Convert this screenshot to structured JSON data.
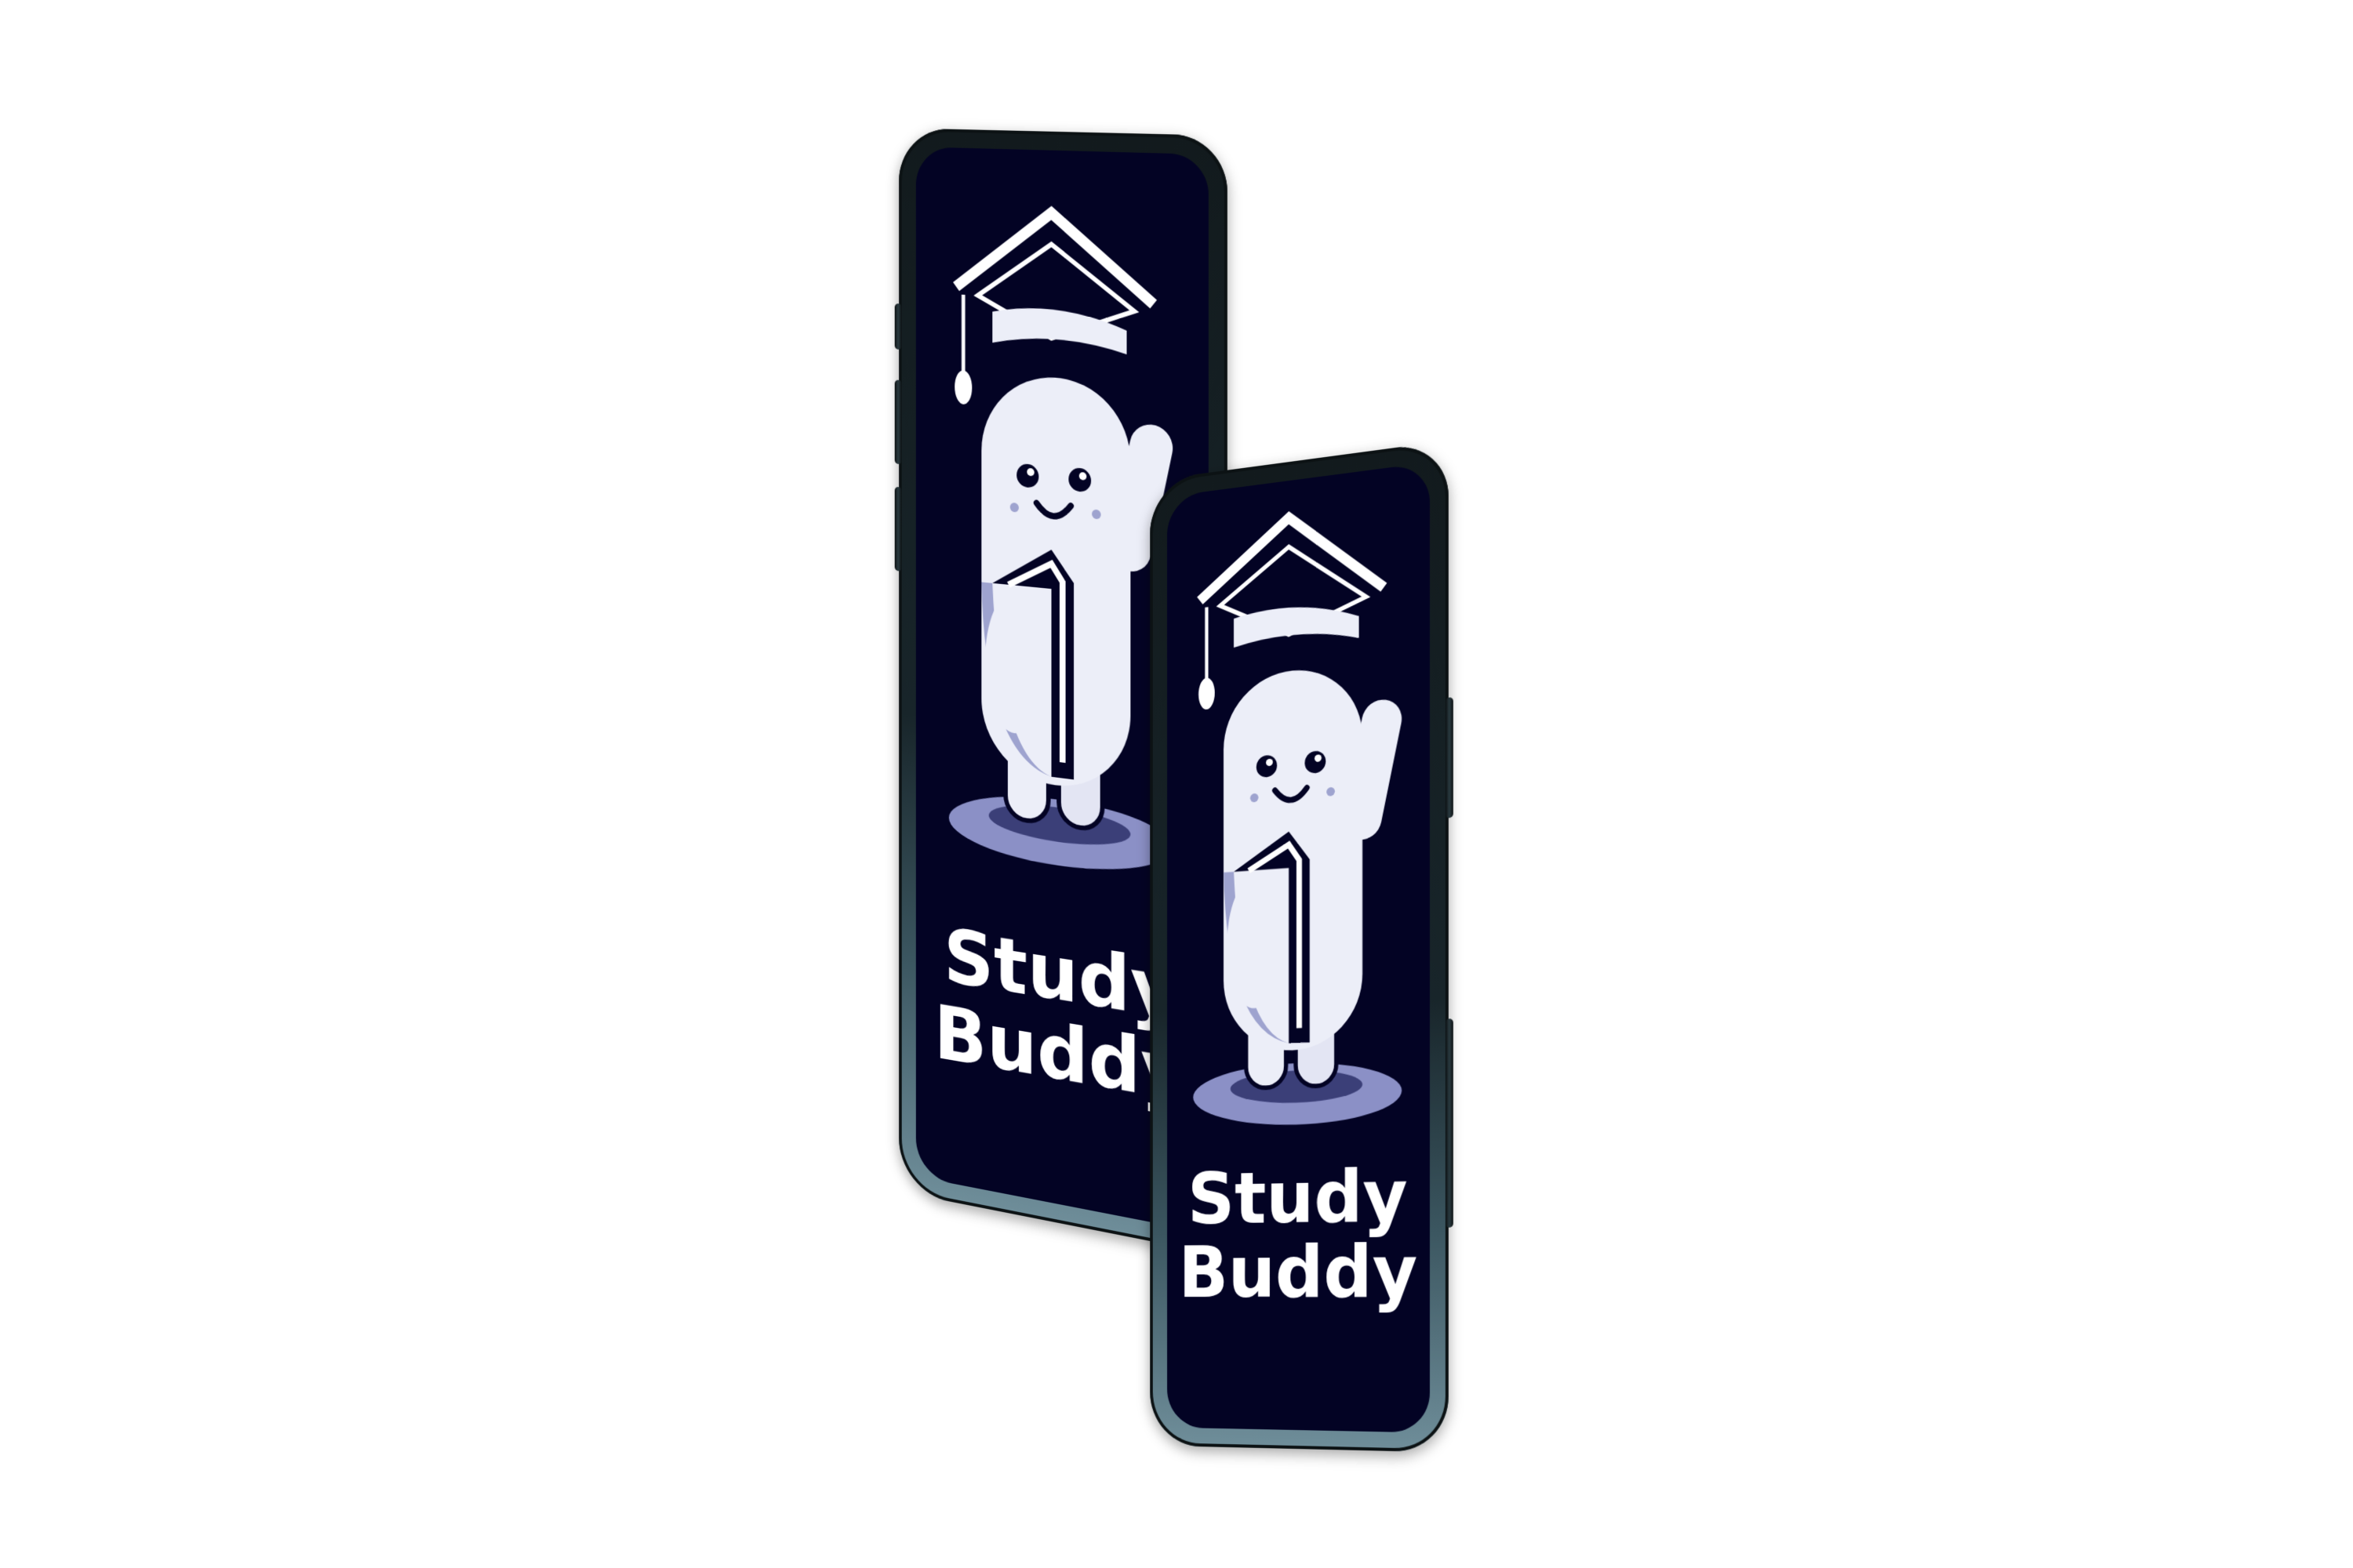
{
  "colors": {
    "screen_background": "#030324",
    "mascot_body": "#eceef8",
    "mascot_shade": "#9ea3cf",
    "cap": "#ffffff",
    "platform": "#8b90c6",
    "text": "#ffffff",
    "frame_top": "#121a1d",
    "frame_bottom": "#6f8e9a"
  },
  "icons": {
    "mascot": "student-mascot-icon",
    "cap": "graduation-cap-icon",
    "book": "book-icon"
  },
  "phones": [
    {
      "app_name_line1": "Study",
      "app_name_line2": "Buddy"
    },
    {
      "app_name_line1": "Study",
      "app_name_line2": "Buddy"
    }
  ]
}
